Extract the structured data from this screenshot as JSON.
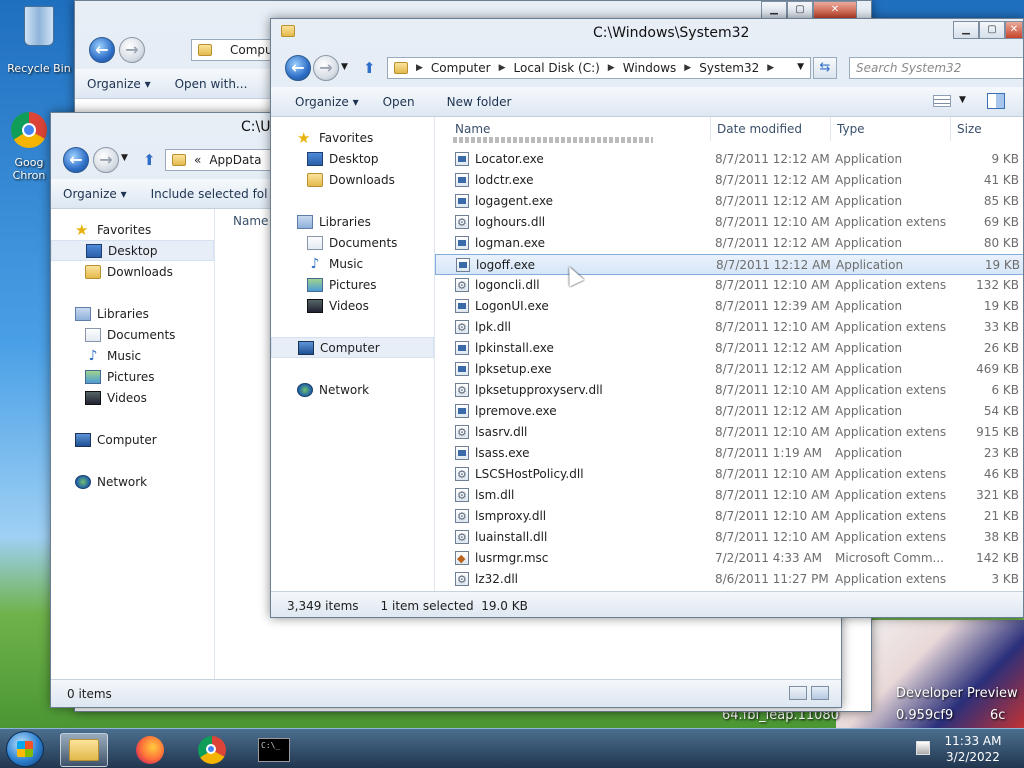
{
  "desktop": {
    "icons": [
      {
        "label": "Recycle Bin"
      },
      {
        "label": "Goog Chron"
      }
    ],
    "watermark": {
      "line1": "Developer Preview",
      "line2": "64.fbl_leap.11080",
      "line3": "0.959cf9",
      "line4": "6c"
    }
  },
  "bg_window": {
    "crumb_label": "Compu",
    "toolbar": {
      "organize": "Organize ▾",
      "open_with": "Open with..."
    },
    "nav_item": "Favorites"
  },
  "mid_window": {
    "title": "C:\\U",
    "crumb_prefix": "«",
    "crumb_label": "AppData",
    "toolbar": {
      "organize": "Organize ▾",
      "include": "Include selected fol"
    },
    "column_name": "Name",
    "nav": {
      "favorites": "Favorites",
      "desktop": "Desktop",
      "downloads": "Downloads",
      "libraries": "Libraries",
      "documents": "Documents",
      "music": "Music",
      "pictures": "Pictures",
      "videos": "Videos",
      "computer": "Computer",
      "network": "Network"
    },
    "status": "0 items"
  },
  "main_window": {
    "title": "C:\\Windows\\System32",
    "breadcrumb": [
      "Computer",
      "Local Disk (C:)",
      "Windows",
      "System32"
    ],
    "search_placeholder": "Search System32",
    "toolbar": {
      "organize": "Organize ▾",
      "open": "Open",
      "new_folder": "New folder"
    },
    "nav": {
      "favorites": "Favorites",
      "desktop": "Desktop",
      "downloads": "Downloads",
      "libraries": "Libraries",
      "documents": "Documents",
      "music": "Music",
      "pictures": "Pictures",
      "videos": "Videos",
      "computer": "Computer",
      "network": "Network"
    },
    "columns": {
      "name": "Name",
      "date": "Date modified",
      "type": "Type",
      "size": "Size"
    },
    "files": [
      {
        "name": "Locator.exe",
        "date": "8/7/2011 12:12 AM",
        "type": "Application",
        "size": "9 KB",
        "icon": "exe"
      },
      {
        "name": "lodctr.exe",
        "date": "8/7/2011 12:12 AM",
        "type": "Application",
        "size": "41 KB",
        "icon": "exe"
      },
      {
        "name": "logagent.exe",
        "date": "8/7/2011 12:12 AM",
        "type": "Application",
        "size": "85 KB",
        "icon": "exe"
      },
      {
        "name": "loghours.dll",
        "date": "8/7/2011 12:10 AM",
        "type": "Application extens...",
        "size": "69 KB",
        "icon": "dll"
      },
      {
        "name": "logman.exe",
        "date": "8/7/2011 12:12 AM",
        "type": "Application",
        "size": "80 KB",
        "icon": "exe"
      },
      {
        "name": "logoff.exe",
        "date": "8/7/2011 12:12 AM",
        "type": "Application",
        "size": "19 KB",
        "icon": "exe"
      },
      {
        "name": "logoncli.dll",
        "date": "8/7/2011 12:10 AM",
        "type": "Application extens...",
        "size": "132 KB",
        "icon": "dll"
      },
      {
        "name": "LogonUI.exe",
        "date": "8/7/2011 12:39 AM",
        "type": "Application",
        "size": "19 KB",
        "icon": "exe"
      },
      {
        "name": "lpk.dll",
        "date": "8/7/2011 12:10 AM",
        "type": "Application extens...",
        "size": "33 KB",
        "icon": "dll"
      },
      {
        "name": "lpkinstall.exe",
        "date": "8/7/2011 12:12 AM",
        "type": "Application",
        "size": "26 KB",
        "icon": "exe"
      },
      {
        "name": "lpksetup.exe",
        "date": "8/7/2011 12:12 AM",
        "type": "Application",
        "size": "469 KB",
        "icon": "exe"
      },
      {
        "name": "lpksetupproxyserv.dll",
        "date": "8/7/2011 12:10 AM",
        "type": "Application extens...",
        "size": "6 KB",
        "icon": "dll"
      },
      {
        "name": "lpremove.exe",
        "date": "8/7/2011 12:12 AM",
        "type": "Application",
        "size": "54 KB",
        "icon": "exe"
      },
      {
        "name": "lsasrv.dll",
        "date": "8/7/2011 12:10 AM",
        "type": "Application extens...",
        "size": "915 KB",
        "icon": "dll"
      },
      {
        "name": "lsass.exe",
        "date": "8/7/2011 1:19 AM",
        "type": "Application",
        "size": "23 KB",
        "icon": "exe"
      },
      {
        "name": "LSCSHostPolicy.dll",
        "date": "8/7/2011 12:10 AM",
        "type": "Application extens...",
        "size": "46 KB",
        "icon": "dll"
      },
      {
        "name": "lsm.dll",
        "date": "8/7/2011 12:10 AM",
        "type": "Application extens...",
        "size": "321 KB",
        "icon": "dll"
      },
      {
        "name": "lsmproxy.dll",
        "date": "8/7/2011 12:10 AM",
        "type": "Application extens...",
        "size": "21 KB",
        "icon": "dll"
      },
      {
        "name": "luainstall.dll",
        "date": "8/7/2011 12:10 AM",
        "type": "Application extens...",
        "size": "38 KB",
        "icon": "dll"
      },
      {
        "name": "lusrmgr.msc",
        "date": "7/2/2011 4:33 AM",
        "type": "Microsoft Comm...",
        "size": "142 KB",
        "icon": "msc"
      },
      {
        "name": "lz32.dll",
        "date": "8/6/2011 11:27 PM",
        "type": "Application extens...",
        "size": "3 KB",
        "icon": "dll"
      }
    ],
    "status": {
      "items": "3,349 items",
      "selected": "1 item selected  19.0 KB"
    }
  },
  "taskbar": {
    "clock_time": "11:33 AM",
    "clock_date": "3/2/2022",
    "cmd_text": "C:\\_"
  }
}
